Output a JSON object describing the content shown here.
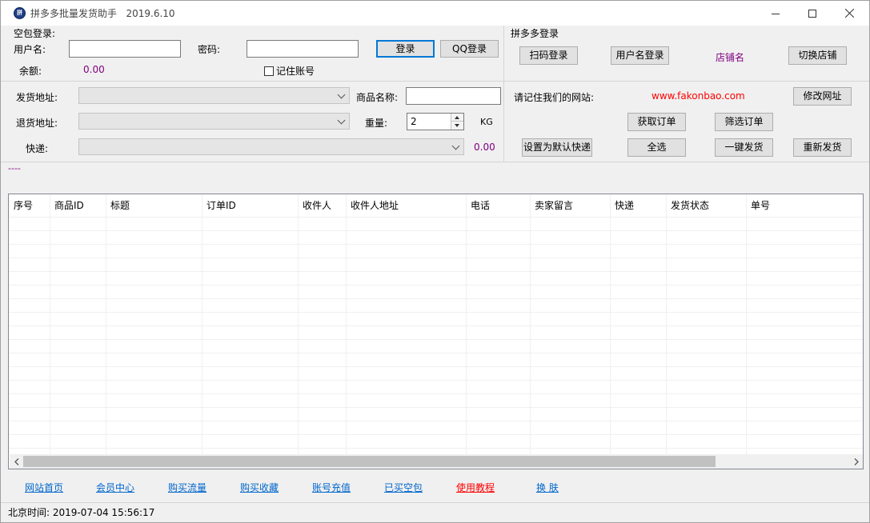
{
  "window": {
    "title": "拼多多批量发货助手",
    "version": "2019.6.10",
    "icon": "app-logo-icon",
    "icon_glyph": "拼"
  },
  "login": {
    "section_label": "空包登录:",
    "username_label": "用户名:",
    "username_value": "",
    "password_label": "密码:",
    "password_value": "",
    "login_button": "登录",
    "qq_login_button": "QQ登录",
    "balance_label": "余额:",
    "balance_value": "0.00",
    "remember_label": "记住账号",
    "remember_checked": false
  },
  "pdd": {
    "section_label": "拼多多登录",
    "scan_login_button": "扫码登录",
    "username_login_button": "用户名登录",
    "shop_name": "店铺名",
    "switch_shop_button": "切换店铺"
  },
  "shipping": {
    "ship_address_label": "发货地址:",
    "ship_address_value": "",
    "return_address_label": "退货地址:",
    "return_address_value": "",
    "express_label": "快递:",
    "express_value": "",
    "express_price": "0.00",
    "product_name_label": "商品名称:",
    "product_name_value": "",
    "weight_label": "重量:",
    "weight_value": "2",
    "weight_unit": "KG"
  },
  "website": {
    "remember_label": "请记住我们的网站:",
    "url": "www.fakonbao.com",
    "modify_button": "修改网址",
    "fetch_orders_button": "获取订单",
    "filter_orders_button": "筛选订单",
    "set_default_express_button": "设置为默认快递",
    "select_all_button": "全选",
    "one_click_ship_button": "一键发货",
    "reship_button": "重新发货"
  },
  "log_text": "----",
  "table": {
    "columns": [
      "序号",
      "商品ID",
      "标题",
      "订单ID",
      "收件人",
      "收件人地址",
      "电话",
      "卖家留言",
      "快递",
      "发货状态",
      "单号"
    ],
    "rows": []
  },
  "links": {
    "home": "网站首页",
    "member": "会员中心",
    "buy_traffic": "购买流量",
    "buy_favorites": "购买收藏",
    "recharge": "账号充值",
    "bought_packages": "已买空包",
    "tutorial": "使用教程",
    "skin": "换 肤"
  },
  "status": {
    "time_label": "北京时间:",
    "time_value": "2019-07-04 15:56:17"
  },
  "colors": {
    "accent_purple": "#800080",
    "url_red": "#ff0000",
    "link_blue": "#0066cc",
    "primary_border": "#0078d7"
  }
}
